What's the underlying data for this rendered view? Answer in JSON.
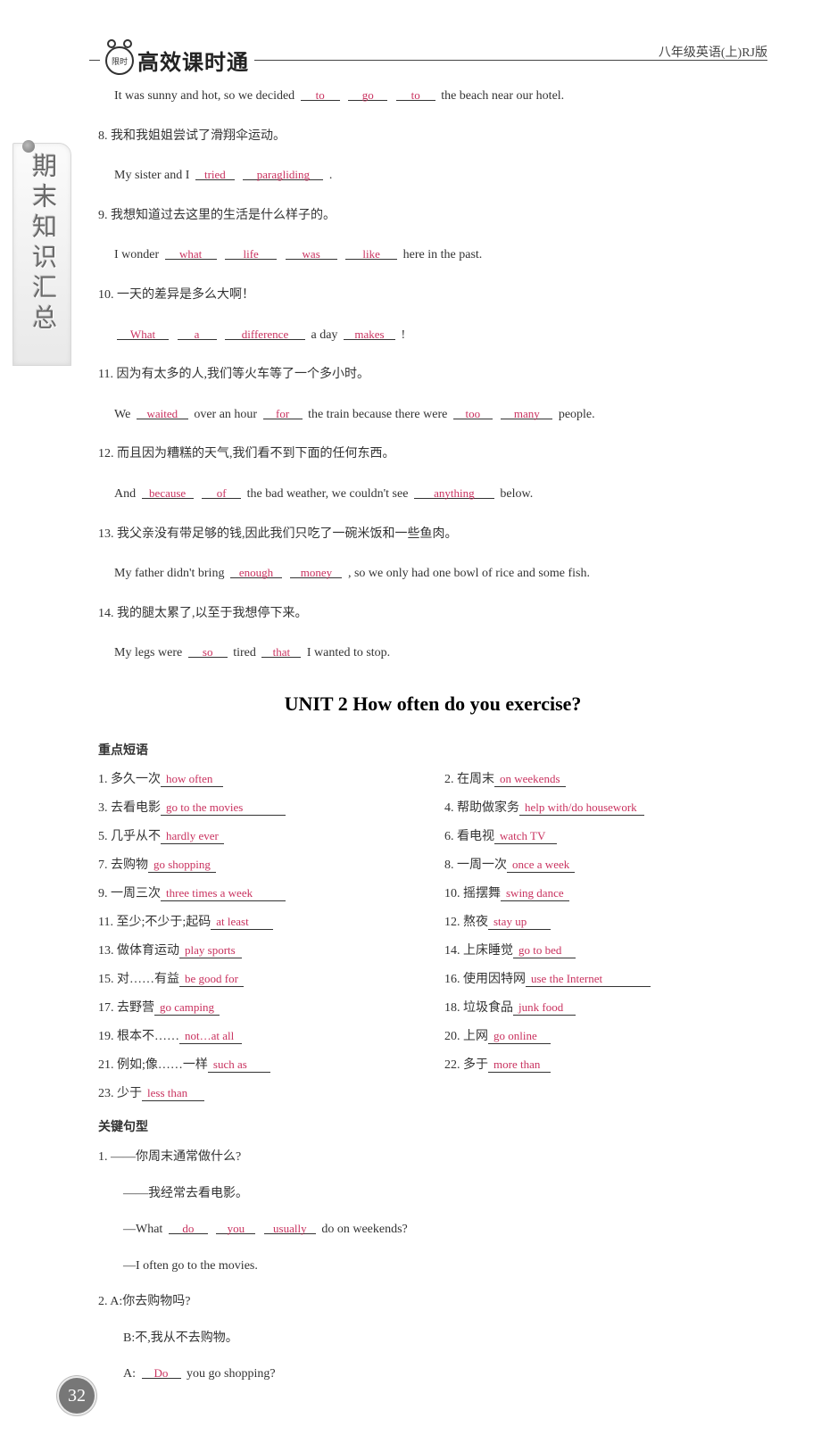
{
  "header": {
    "brand": "高效课时通",
    "clock_label": "限时",
    "top_right": "八年级英语(上)RJ版"
  },
  "side_tab": "期末知识汇总",
  "page_number": "32",
  "part1": {
    "intro_line_text_before": "It was sunny and hot, so we decided",
    "intro_blanks": [
      "to",
      "go",
      "to"
    ],
    "intro_line_text_after": "the beach near our hotel.",
    "items": [
      {
        "num": "8",
        "zh": "我和我姐姐尝试了滑翔伞运动。",
        "en_before": "My sister and I",
        "blanks": [
          "tried",
          "paragliding"
        ],
        "en_after": "."
      },
      {
        "num": "9",
        "zh": "我想知道过去这里的生活是什么样子的。",
        "en_before": "I wonder",
        "blanks": [
          "what",
          "life",
          "was",
          "like"
        ],
        "en_after": "here in the past."
      },
      {
        "num": "10",
        "zh": "一天的差异是多么大啊！",
        "en_before": "",
        "blanks": [
          "What",
          "a",
          "difference"
        ],
        "en_mid": "a day",
        "blanks2": [
          "makes"
        ],
        "en_after": "!"
      },
      {
        "num": "11",
        "zh": "因为有太多的人,我们等火车等了一个多小时。",
        "en_before": "We",
        "blanks": [
          "waited"
        ],
        "en_mid": "over an hour",
        "blanks2": [
          "for"
        ],
        "en_mid2": "the train because there were",
        "blanks3": [
          "too",
          "many"
        ],
        "en_after": "people."
      },
      {
        "num": "12",
        "zh": "而且因为糟糕的天气,我们看不到下面的任何东西。",
        "en_before": "And",
        "blanks": [
          "because",
          "of"
        ],
        "en_mid": "the bad weather, we couldn't see",
        "blanks2": [
          "anything"
        ],
        "en_after": "below."
      },
      {
        "num": "13",
        "zh": "我父亲没有带足够的钱,因此我们只吃了一碗米饭和一些鱼肉。",
        "en_before": "My father didn't bring",
        "blanks": [
          "enough",
          "money"
        ],
        "en_after": ", so we only had one bowl of rice and some fish."
      },
      {
        "num": "14",
        "zh": "我的腿太累了,以至于我想停下来。",
        "en_before": "My legs were",
        "blanks": [
          "so"
        ],
        "en_mid": "tired",
        "blanks2": [
          "that"
        ],
        "en_after": "I wanted to stop."
      }
    ]
  },
  "unit_title": "UNIT 2   How often do you exercise?",
  "section_phrases_label": "重点短语",
  "phrases": [
    {
      "n": "1",
      "zh": "多久一次",
      "ans": "how often"
    },
    {
      "n": "2",
      "zh": "在周末",
      "ans": "on weekends"
    },
    {
      "n": "3",
      "zh": "去看电影",
      "ans": "go to the movies"
    },
    {
      "n": "4",
      "zh": "帮助做家务",
      "ans": "help with/do housework"
    },
    {
      "n": "5",
      "zh": "几乎从不",
      "ans": "hardly ever"
    },
    {
      "n": "6",
      "zh": "看电视",
      "ans": "watch TV"
    },
    {
      "n": "7",
      "zh": "去购物",
      "ans": "go shopping"
    },
    {
      "n": "8",
      "zh": "一周一次",
      "ans": "once a week"
    },
    {
      "n": "9",
      "zh": "一周三次",
      "ans": "three times a week"
    },
    {
      "n": "10",
      "zh": "摇摆舞",
      "ans": "swing dance"
    },
    {
      "n": "11",
      "zh": "至少;不少于;起码",
      "ans": "at least"
    },
    {
      "n": "12",
      "zh": "熬夜",
      "ans": "stay up"
    },
    {
      "n": "13",
      "zh": "做体育运动",
      "ans": "play sports"
    },
    {
      "n": "14",
      "zh": "上床睡觉",
      "ans": "go to bed"
    },
    {
      "n": "15",
      "zh": "对……有益",
      "ans": "be good for"
    },
    {
      "n": "16",
      "zh": "使用因特网",
      "ans": "use the Internet"
    },
    {
      "n": "17",
      "zh": "去野营",
      "ans": "go camping"
    },
    {
      "n": "18",
      "zh": "垃圾食品",
      "ans": "junk food"
    },
    {
      "n": "19",
      "zh": "根本不……",
      "ans": "not…at all"
    },
    {
      "n": "20",
      "zh": "上网",
      "ans": "go online"
    },
    {
      "n": "21",
      "zh": "例如;像……一样",
      "ans": "such as"
    },
    {
      "n": "22",
      "zh": "多于",
      "ans": "more than"
    },
    {
      "n": "23",
      "zh": "少于",
      "ans": "less than"
    }
  ],
  "section_sentences_label": "关键句型",
  "sentences": {
    "q1": {
      "num": "1",
      "zh_q": "——你周末通常做什么?",
      "zh_a": "——我经常去看电影。",
      "en_q_before": "—What",
      "en_q_blanks": [
        "do",
        "you",
        "usually"
      ],
      "en_q_after": "do on weekends?",
      "en_a": "—I often go to the movies."
    },
    "q2": {
      "num": "2",
      "zh_a_line": "A:你去购物吗?",
      "zh_b_line": "B:不,我从不去购物。",
      "en_a_before": "A:",
      "en_a_blanks": [
        "Do"
      ],
      "en_a_after": "you go shopping?"
    }
  }
}
